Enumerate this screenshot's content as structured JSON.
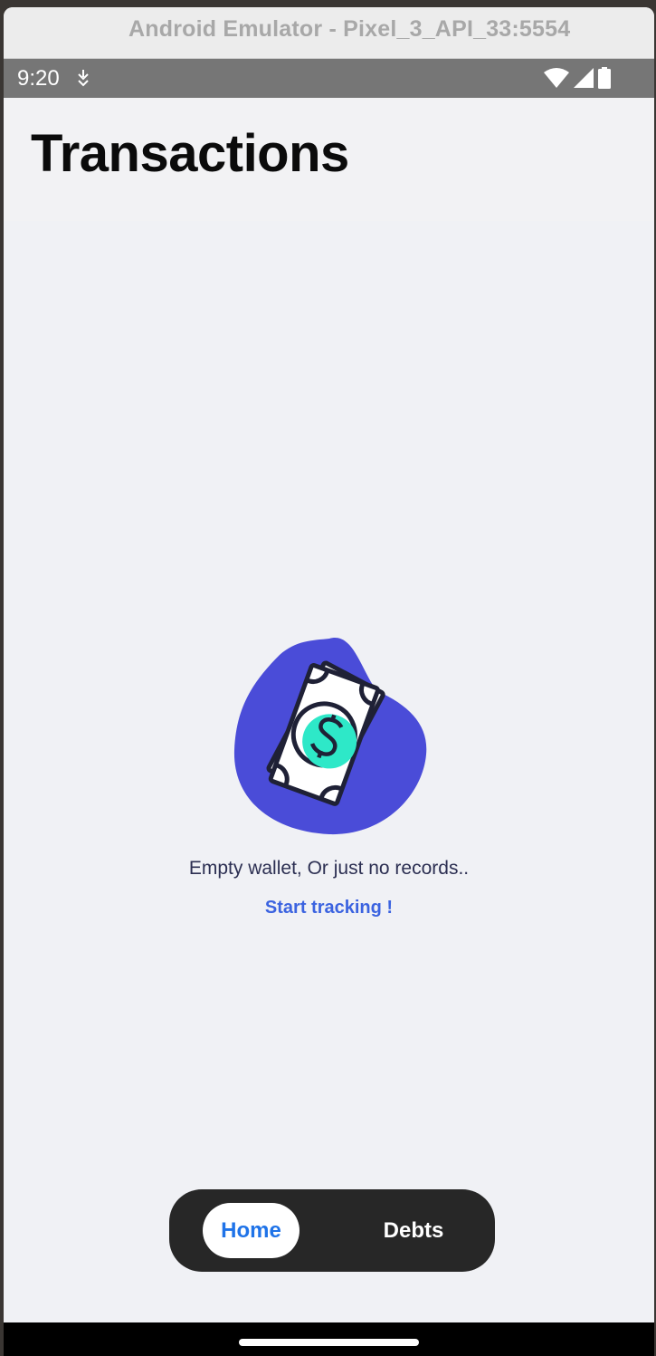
{
  "window": {
    "title": "Android Emulator - Pixel_3_API_33:5554"
  },
  "status_bar": {
    "time": "9:20",
    "icons": [
      "download-icon",
      "wifi-icon",
      "signal-icon",
      "battery-icon"
    ]
  },
  "header": {
    "title": "Transactions"
  },
  "empty_state": {
    "illustration": "money-bill-icon",
    "message": "Empty wallet, Or just no records..",
    "action_label": "Start tracking !"
  },
  "bottom_nav": {
    "items": [
      {
        "label": "Home",
        "active": true
      },
      {
        "label": "Debts",
        "active": false
      }
    ]
  },
  "colors": {
    "accent": "#1f73e8",
    "link": "#3b63e0",
    "blob": "#4a4cd8",
    "coin": "#2ee8c8",
    "nav_background": "#272727"
  }
}
